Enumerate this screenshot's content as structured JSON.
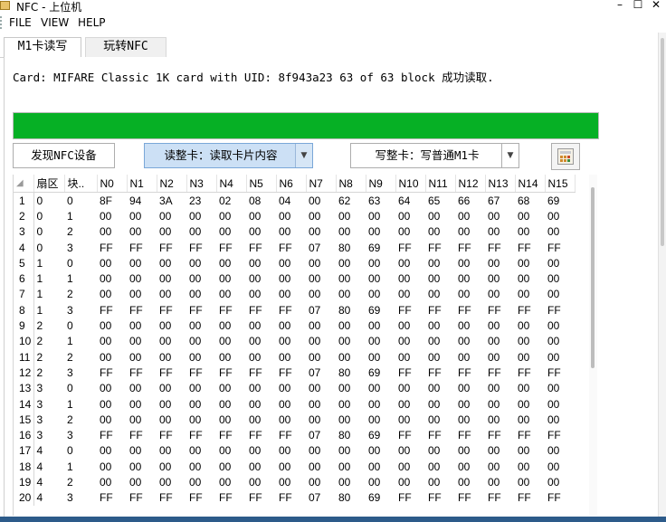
{
  "window": {
    "title": "NFC - 上位机",
    "min": "–",
    "max": "☐",
    "close": "✕"
  },
  "menu": {
    "items": [
      "FILE",
      "VIEW",
      "HELP"
    ]
  },
  "tabs": [
    "M1卡读写",
    "玩转NFC"
  ],
  "status_text": "Card: MIFARE Classic 1K card with UID: 8f943a23 63 of 63 block 成功读取.",
  "progress": {
    "fraction": 1.0,
    "color": "#06b025"
  },
  "toolbar": {
    "discover_label": "发现NFC设备",
    "read_combo_value": "读整卡：读取卡片内容",
    "write_combo_value": "写整卡：写普通M1卡",
    "dropdown_arrow": "▼",
    "calculator_icon": "calculator-icon"
  },
  "grid": {
    "corner": "◢",
    "columns": [
      "扇区",
      "块..",
      "N0",
      "N1",
      "N2",
      "N3",
      "N4",
      "N5",
      "N6",
      "N7",
      "N8",
      "N9",
      "N10",
      "N11",
      "N12",
      "N13",
      "N14",
      "N15"
    ],
    "rows": [
      {
        "n": "1",
        "sector": "0",
        "block": "0",
        "bytes": [
          "8F",
          "94",
          "3A",
          "23",
          "02",
          "08",
          "04",
          "00",
          "62",
          "63",
          "64",
          "65",
          "66",
          "67",
          "68",
          "69"
        ]
      },
      {
        "n": "2",
        "sector": "0",
        "block": "1",
        "bytes": [
          "00",
          "00",
          "00",
          "00",
          "00",
          "00",
          "00",
          "00",
          "00",
          "00",
          "00",
          "00",
          "00",
          "00",
          "00",
          "00"
        ]
      },
      {
        "n": "3",
        "sector": "0",
        "block": "2",
        "bytes": [
          "00",
          "00",
          "00",
          "00",
          "00",
          "00",
          "00",
          "00",
          "00",
          "00",
          "00",
          "00",
          "00",
          "00",
          "00",
          "00"
        ]
      },
      {
        "n": "4",
        "sector": "0",
        "block": "3",
        "bytes": [
          "FF",
          "FF",
          "FF",
          "FF",
          "FF",
          "FF",
          "FF",
          "07",
          "80",
          "69",
          "FF",
          "FF",
          "FF",
          "FF",
          "FF",
          "FF"
        ]
      },
      {
        "n": "5",
        "sector": "1",
        "block": "0",
        "bytes": [
          "00",
          "00",
          "00",
          "00",
          "00",
          "00",
          "00",
          "00",
          "00",
          "00",
          "00",
          "00",
          "00",
          "00",
          "00",
          "00"
        ]
      },
      {
        "n": "6",
        "sector": "1",
        "block": "1",
        "bytes": [
          "00",
          "00",
          "00",
          "00",
          "00",
          "00",
          "00",
          "00",
          "00",
          "00",
          "00",
          "00",
          "00",
          "00",
          "00",
          "00"
        ]
      },
      {
        "n": "7",
        "sector": "1",
        "block": "2",
        "bytes": [
          "00",
          "00",
          "00",
          "00",
          "00",
          "00",
          "00",
          "00",
          "00",
          "00",
          "00",
          "00",
          "00",
          "00",
          "00",
          "00"
        ]
      },
      {
        "n": "8",
        "sector": "1",
        "block": "3",
        "bytes": [
          "FF",
          "FF",
          "FF",
          "FF",
          "FF",
          "FF",
          "FF",
          "07",
          "80",
          "69",
          "FF",
          "FF",
          "FF",
          "FF",
          "FF",
          "FF"
        ]
      },
      {
        "n": "9",
        "sector": "2",
        "block": "0",
        "bytes": [
          "00",
          "00",
          "00",
          "00",
          "00",
          "00",
          "00",
          "00",
          "00",
          "00",
          "00",
          "00",
          "00",
          "00",
          "00",
          "00"
        ]
      },
      {
        "n": "10",
        "sector": "2",
        "block": "1",
        "bytes": [
          "00",
          "00",
          "00",
          "00",
          "00",
          "00",
          "00",
          "00",
          "00",
          "00",
          "00",
          "00",
          "00",
          "00",
          "00",
          "00"
        ]
      },
      {
        "n": "11",
        "sector": "2",
        "block": "2",
        "bytes": [
          "00",
          "00",
          "00",
          "00",
          "00",
          "00",
          "00",
          "00",
          "00",
          "00",
          "00",
          "00",
          "00",
          "00",
          "00",
          "00"
        ]
      },
      {
        "n": "12",
        "sector": "2",
        "block": "3",
        "bytes": [
          "FF",
          "FF",
          "FF",
          "FF",
          "FF",
          "FF",
          "FF",
          "07",
          "80",
          "69",
          "FF",
          "FF",
          "FF",
          "FF",
          "FF",
          "FF"
        ]
      },
      {
        "n": "13",
        "sector": "3",
        "block": "0",
        "bytes": [
          "00",
          "00",
          "00",
          "00",
          "00",
          "00",
          "00",
          "00",
          "00",
          "00",
          "00",
          "00",
          "00",
          "00",
          "00",
          "00"
        ]
      },
      {
        "n": "14",
        "sector": "3",
        "block": "1",
        "bytes": [
          "00",
          "00",
          "00",
          "00",
          "00",
          "00",
          "00",
          "00",
          "00",
          "00",
          "00",
          "00",
          "00",
          "00",
          "00",
          "00"
        ]
      },
      {
        "n": "15",
        "sector": "3",
        "block": "2",
        "bytes": [
          "00",
          "00",
          "00",
          "00",
          "00",
          "00",
          "00",
          "00",
          "00",
          "00",
          "00",
          "00",
          "00",
          "00",
          "00",
          "00"
        ]
      },
      {
        "n": "16",
        "sector": "3",
        "block": "3",
        "bytes": [
          "FF",
          "FF",
          "FF",
          "FF",
          "FF",
          "FF",
          "FF",
          "07",
          "80",
          "69",
          "FF",
          "FF",
          "FF",
          "FF",
          "FF",
          "FF"
        ]
      },
      {
        "n": "17",
        "sector": "4",
        "block": "0",
        "bytes": [
          "00",
          "00",
          "00",
          "00",
          "00",
          "00",
          "00",
          "00",
          "00",
          "00",
          "00",
          "00",
          "00",
          "00",
          "00",
          "00"
        ]
      },
      {
        "n": "18",
        "sector": "4",
        "block": "1",
        "bytes": [
          "00",
          "00",
          "00",
          "00",
          "00",
          "00",
          "00",
          "00",
          "00",
          "00",
          "00",
          "00",
          "00",
          "00",
          "00",
          "00"
        ]
      },
      {
        "n": "19",
        "sector": "4",
        "block": "2",
        "bytes": [
          "00",
          "00",
          "00",
          "00",
          "00",
          "00",
          "00",
          "00",
          "00",
          "00",
          "00",
          "00",
          "00",
          "00",
          "00",
          "00"
        ]
      },
      {
        "n": "20",
        "sector": "4",
        "block": "3",
        "bytes": [
          "FF",
          "FF",
          "FF",
          "FF",
          "FF",
          "FF",
          "FF",
          "07",
          "80",
          "69",
          "FF",
          "FF",
          "FF",
          "FF",
          "FF",
          "FF"
        ]
      }
    ]
  }
}
